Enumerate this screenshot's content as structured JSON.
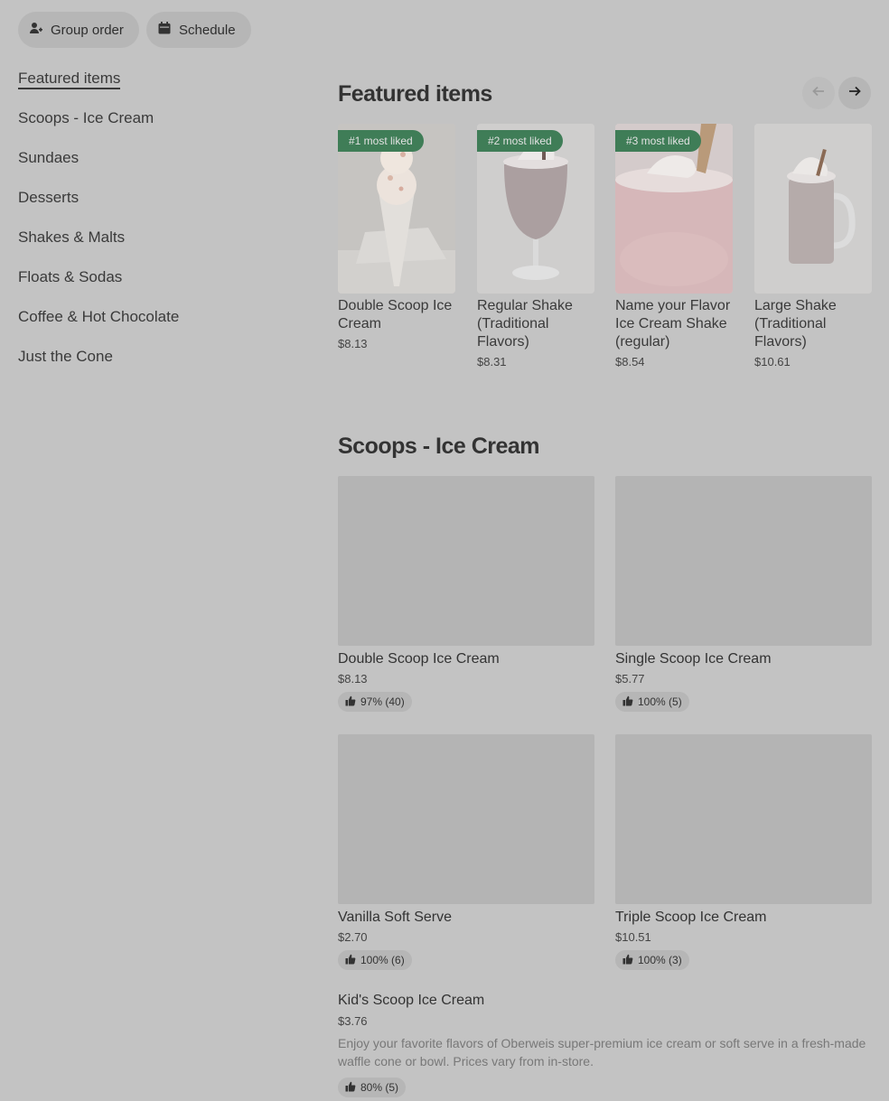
{
  "header": {
    "group_order_label": "Group order",
    "schedule_label": "Schedule"
  },
  "sidebar": {
    "items": [
      {
        "label": "Featured items"
      },
      {
        "label": "Scoops - Ice Cream"
      },
      {
        "label": "Sundaes"
      },
      {
        "label": "Desserts"
      },
      {
        "label": "Shakes & Malts"
      },
      {
        "label": "Floats & Sodas"
      },
      {
        "label": "Coffee & Hot Chocolate"
      },
      {
        "label": "Just the Cone"
      }
    ]
  },
  "featured": {
    "title": "Featured items",
    "items": [
      {
        "badge": "#1 most liked",
        "name": "Double Scoop Ice Cream",
        "price": "$8.13"
      },
      {
        "badge": "#2 most liked",
        "name": "Regular Shake (Traditional Flavors)",
        "price": "$8.31"
      },
      {
        "badge": "#3 most liked",
        "name": "Name your Flavor Ice Cream Shake (regular)",
        "price": "$8.54"
      },
      {
        "badge": "",
        "name": "Large Shake (Traditional Flavors)",
        "price": "$10.61"
      }
    ]
  },
  "scoops": {
    "title": "Scoops - Ice Cream",
    "items": [
      {
        "name": "Double Scoop Ice Cream",
        "price": "$8.13",
        "rating": "97% (40)"
      },
      {
        "name": "Single Scoop Ice Cream",
        "price": "$5.77",
        "rating": "100% (5)"
      },
      {
        "name": "Vanilla Soft Serve",
        "price": "$2.70",
        "rating": "100% (6)"
      },
      {
        "name": "Triple Scoop Ice Cream",
        "price": "$10.51",
        "rating": "100% (3)"
      }
    ],
    "kids": {
      "name": "Kid's Scoop Ice Cream",
      "price": "$3.76",
      "description": "Enjoy your favorite flavors of Oberweis super-premium ice cream or soft serve in a fresh-made waffle cone or bowl. Prices vary from in-store.",
      "rating": "80% (5)"
    }
  },
  "colors": {
    "badge_green": "#3f7d57",
    "overlay_gray": "#c3c3c3"
  }
}
